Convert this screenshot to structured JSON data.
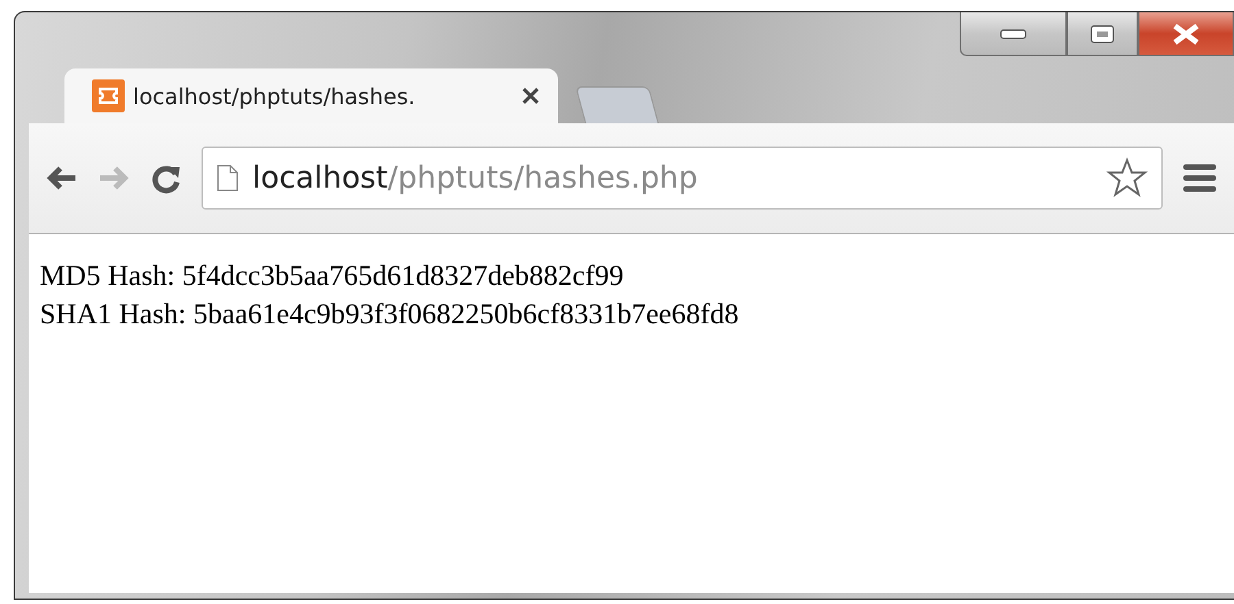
{
  "tabs": [
    {
      "title": "localhost/phptuts/hashes.",
      "selected": true
    }
  ],
  "toolbar": {
    "back": {
      "disabled": false
    },
    "forward": {
      "disabled": true
    },
    "address": {
      "host": "localhost",
      "path": "/phptuts/hashes.php"
    }
  },
  "page": {
    "lines": [
      "MD5 Hash: 5f4dcc3b5aa765d61d8327deb882cf99",
      "SHA1 Hash: 5baa61e4c9b93f3f0682250b6cf8331b7ee68fd8"
    ]
  }
}
